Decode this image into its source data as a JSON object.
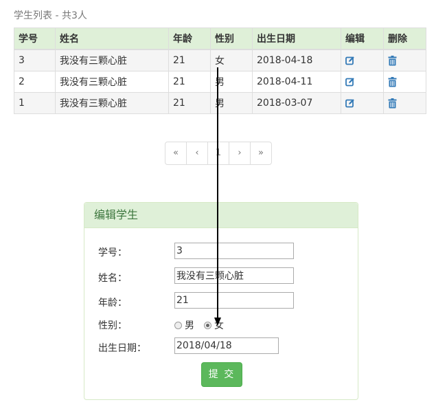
{
  "caption": "学生列表 - 共3人",
  "table": {
    "headers": [
      "学号",
      "姓名",
      "年龄",
      "性别",
      "出生日期",
      "编辑",
      "删除"
    ],
    "rows": [
      {
        "id": "3",
        "name": "我没有三颗心脏",
        "age": "21",
        "gender": "女",
        "birth": "2018-04-18"
      },
      {
        "id": "2",
        "name": "我没有三颗心脏",
        "age": "21",
        "gender": "男",
        "birth": "2018-04-11"
      },
      {
        "id": "1",
        "name": "我没有三颗心脏",
        "age": "21",
        "gender": "男",
        "birth": "2018-03-07"
      }
    ],
    "edit_icon": "edit-icon",
    "delete_icon": "trash-icon"
  },
  "pagination": {
    "first": "«",
    "prev": "‹",
    "current": "1",
    "next": "›",
    "last": "»"
  },
  "edit_form": {
    "title": "编辑学生",
    "id_label": "学号：",
    "id_value": "3",
    "name_label": "姓名：",
    "name_value": "我没有三颗心脏",
    "age_label": "年龄：",
    "age_value": "21",
    "gender_label": "性别：",
    "gender_options": [
      "男",
      "女"
    ],
    "gender_selected": "女",
    "birth_label": "出生日期：",
    "birth_value": "2018/04/18",
    "submit_label": "提 交"
  },
  "colors": {
    "header_bg": "#dff0d8",
    "panel_title": "#3c763d",
    "icon": "#337ab7",
    "submit_bg": "#5cb85c"
  }
}
